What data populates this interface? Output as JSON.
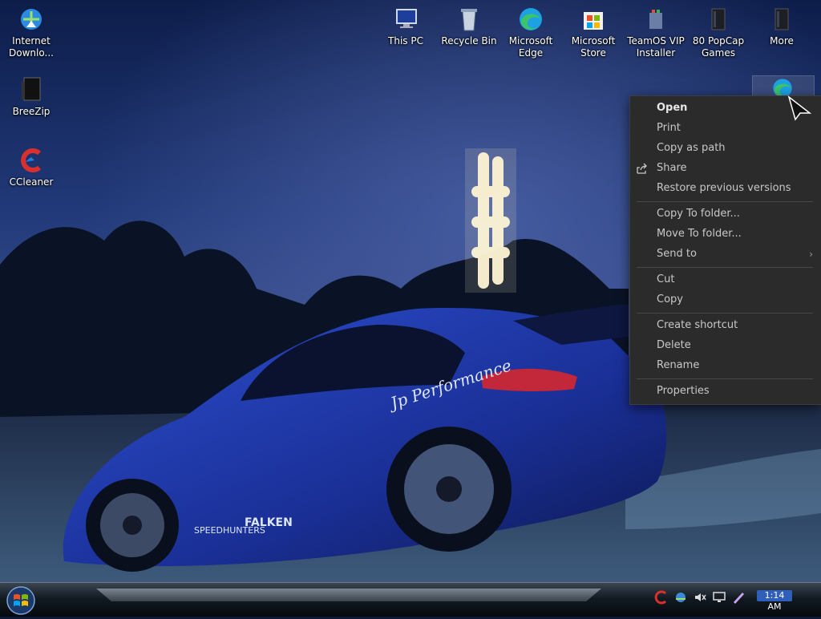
{
  "desktop": {
    "icons": [
      {
        "label": "Internet Downlo...",
        "icon": "idm-icon"
      },
      {
        "label": "BreeZip",
        "icon": "breezip-icon"
      },
      {
        "label": "CCleaner",
        "icon": "ccleaner-icon"
      },
      {
        "label": "This PC",
        "icon": "computer-icon"
      },
      {
        "label": "Recycle Bin",
        "icon": "recycle-bin-icon"
      },
      {
        "label": "Microsoft Edge",
        "icon": "edge-icon"
      },
      {
        "label": "Microsoft Store",
        "icon": "store-icon"
      },
      {
        "label": "TeamOS VIP Installer",
        "icon": "installer-icon"
      },
      {
        "label": "80 PopCap Games",
        "icon": "folder-icon"
      },
      {
        "label": "More",
        "icon": "folder-icon"
      }
    ],
    "selected_icon": "edge-icon"
  },
  "context_menu": {
    "open": "Open",
    "print": "Print",
    "copy_as_path": "Copy as path",
    "share": "Share",
    "restore_previous_versions": "Restore previous versions",
    "copy_to_folder": "Copy To folder...",
    "move_to_folder": "Move To folder...",
    "send_to": "Send to",
    "cut": "Cut",
    "copy": "Copy",
    "create_shortcut": "Create shortcut",
    "delete": "Delete",
    "rename": "Rename",
    "properties": "Properties"
  },
  "taskbar": {
    "clock": "1:14 AM",
    "tray_icons": [
      "ccleaner-icon",
      "network-icon",
      "volume-mute-icon",
      "display-icon",
      "pen-icon"
    ]
  },
  "colors": {
    "menu_bg": "#2b2b2b",
    "menu_text": "#c8c8c8",
    "car_blue": "#1f3fae",
    "clock_highlight": "#2f5fb8"
  }
}
